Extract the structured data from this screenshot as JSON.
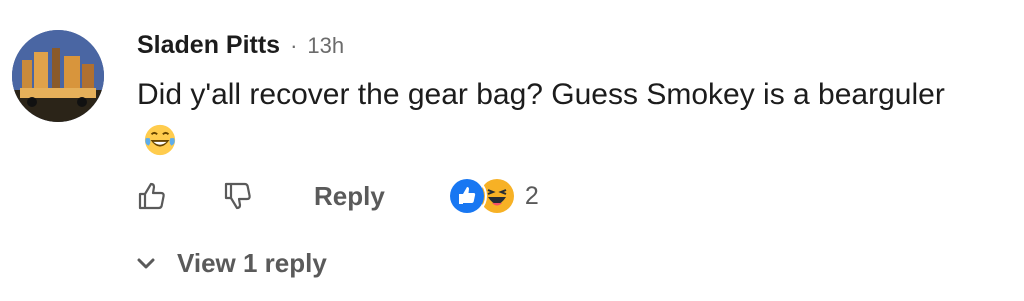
{
  "comment": {
    "author": "Sladen Pitts",
    "separator": "·",
    "time": "13h",
    "text": "Did y'all recover the gear bag? Guess Smokey is a bearguler",
    "emoji": "laughing-tears-emoji"
  },
  "actions": {
    "like_icon": "thumbs-up-outline-icon",
    "dislike_icon": "thumbs-down-outline-icon",
    "reply_label": "Reply"
  },
  "reactions": {
    "icons": [
      "like-reaction-icon",
      "haha-reaction-icon"
    ],
    "count": "2",
    "colors": {
      "like": "#1877F2",
      "haha": "#F7B125"
    }
  },
  "replies": {
    "label": "View 1 reply",
    "icon": "chevron-down-icon"
  },
  "colors": {
    "text": "#1c1c1c",
    "muted": "#5a5a5a"
  }
}
